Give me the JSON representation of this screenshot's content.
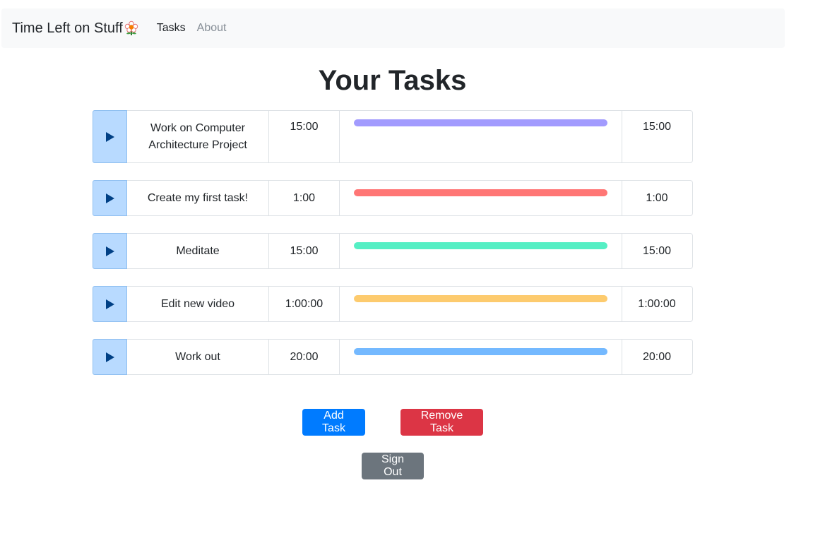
{
  "navbar": {
    "brand": "Time Left on Stuff",
    "brand_icon": "flower-icon",
    "links": [
      {
        "label": "Tasks",
        "active": true
      },
      {
        "label": "About",
        "active": false
      }
    ]
  },
  "page_title": "Your Tasks",
  "tasks": [
    {
      "name": "Work on Computer Architecture Project",
      "duration": "15:00",
      "remaining": "15:00",
      "progress": 1.0,
      "color": "#a29bfe"
    },
    {
      "name": "Create my first task!",
      "duration": "1:00",
      "remaining": "1:00",
      "progress": 1.0,
      "color": "#ff7675"
    },
    {
      "name": "Meditate",
      "duration": "15:00",
      "remaining": "15:00",
      "progress": 1.0,
      "color": "#55efc4"
    },
    {
      "name": "Edit new video",
      "duration": "1:00:00",
      "remaining": "1:00:00",
      "progress": 1.0,
      "color": "#fdcb6e"
    },
    {
      "name": "Work out",
      "duration": "20:00",
      "remaining": "20:00",
      "progress": 1.0,
      "color": "#74b9ff"
    }
  ],
  "buttons": {
    "add": "Add Task",
    "remove": "Remove Task",
    "signout": "Sign Out"
  },
  "colors": {
    "play_button_bg": "#b8daff",
    "play_icon": "#004085",
    "add_button": "#007bff",
    "remove_button": "#dc3545",
    "signout_button": "#6c757d"
  }
}
